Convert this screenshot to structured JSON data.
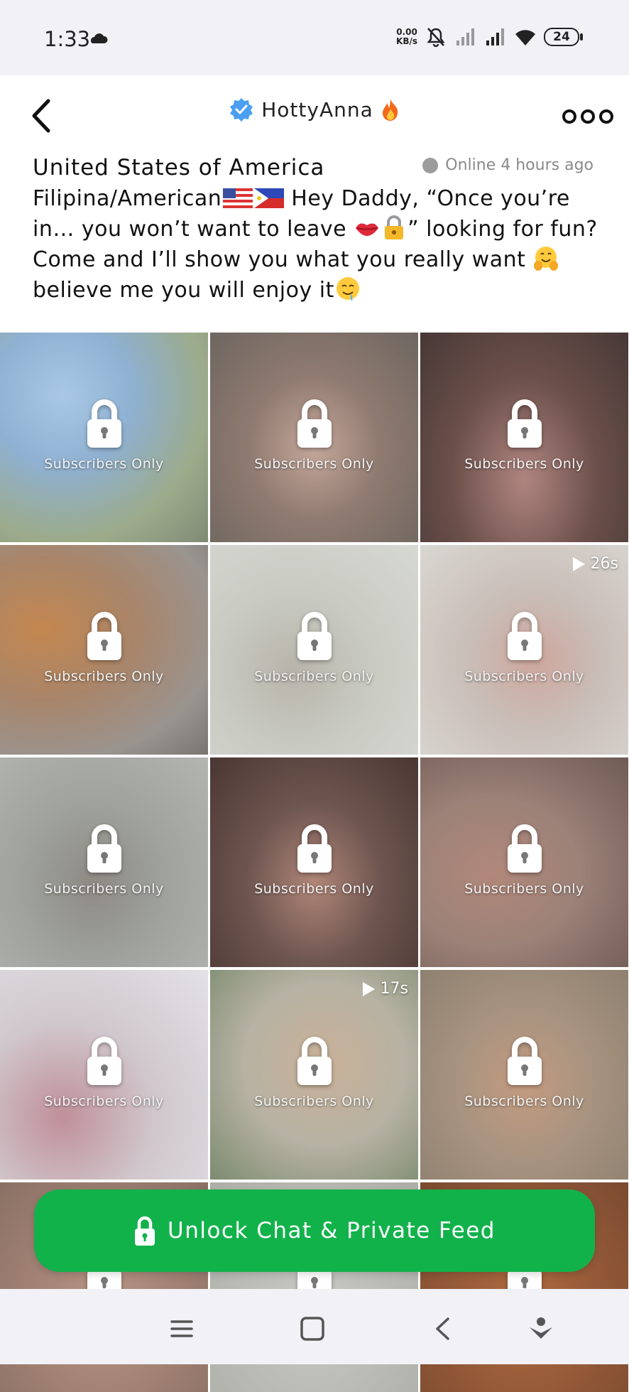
{
  "status_bar": {
    "time": "1:33",
    "net_speed_value": "0.00",
    "net_speed_unit": "KB/s",
    "battery": "24",
    "icons": [
      "cloud-icon",
      "mute-icon",
      "signal-icon",
      "signal-icon",
      "wifi-icon",
      "battery-icon"
    ]
  },
  "header": {
    "title": "HottyAnna",
    "back_icon": "chevron-left-icon",
    "verified_icon": "verified-badge-icon",
    "fire_icon": "fire-emoji-icon",
    "more_icon": "more-options-icon"
  },
  "profile": {
    "country": "United States of America",
    "online_status": "Online 4 hours ago",
    "bio_part1": "Filipina/American",
    "bio_part2": " Hey Daddy, “Once you’re in… you won’t want to leave ",
    "bio_part3": "” looking for fun? Come and I’ll show you what you really want ",
    "bio_part4": " believe me you will enjoy it",
    "emojis": [
      "us-flag",
      "philippines-flag",
      "kiss-lips",
      "lock-with-key",
      "hugging-face",
      "drooling-face"
    ]
  },
  "media_grid": {
    "lock_label": "Subscribers Only",
    "tiles": [
      {
        "duration": ""
      },
      {
        "duration": ""
      },
      {
        "duration": ""
      },
      {
        "duration": ""
      },
      {
        "duration": ""
      },
      {
        "duration": "26s"
      },
      {
        "duration": ""
      },
      {
        "duration": ""
      },
      {
        "duration": ""
      },
      {
        "duration": ""
      },
      {
        "duration": "17s"
      },
      {
        "duration": ""
      },
      {
        "duration": ""
      },
      {
        "duration": ""
      },
      {
        "duration": ""
      }
    ]
  },
  "cta": {
    "label": "Unlock Chat & Private Feed",
    "color": "#12b24b"
  },
  "nav_bar": {
    "icons": [
      "menu-icon",
      "home-square-icon",
      "back-triangle-icon",
      "assistant-icon"
    ]
  }
}
